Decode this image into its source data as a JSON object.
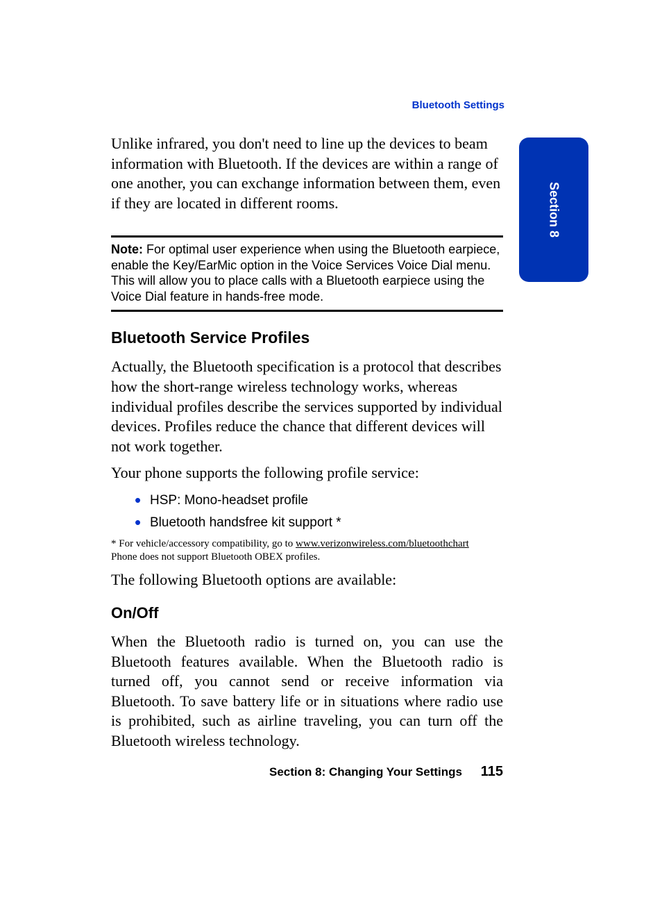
{
  "header": {
    "section_link": "Bluetooth Settings"
  },
  "side_tab": "Section 8",
  "intro": "Unlike infrared, you don't need to line up the devices to beam information with Bluetooth. If the devices are within a range of one another, you can exchange information between them, even if they are located in different rooms.",
  "note": {
    "label": "Note:",
    "text": " For optimal user experience when using the Bluetooth earpiece, enable the Key/EarMic option in the Voice Services Voice Dial menu. This will allow you to place calls with a Bluetooth earpiece using the Voice Dial feature in hands-free mode."
  },
  "h2_profiles": "Bluetooth Service Profiles",
  "profiles_p1": "Actually, the Bluetooth specification is a protocol that describes how the short-range wireless technology works, whereas individual profiles describe the services supported by individual devices. Profiles reduce the chance that different devices will not work together.",
  "profiles_p2": "Your phone supports the following profile service:",
  "bullets": [
    "HSP: Mono-headset profile",
    "Bluetooth handsfree kit support *"
  ],
  "footnote": {
    "prefix": "* For vehicle/accessory compatibility, go to ",
    "link": "www.verizonwireless.com/bluetoothchart",
    "line2": "Phone does not support Bluetooth OBEX profiles."
  },
  "options_intro": "The following Bluetooth options are available:",
  "h3_onoff": "On/Off",
  "onoff_body": "When the Bluetooth radio is turned on, you can use the Bluetooth features available. When the Bluetooth radio is turned off, you cannot send or receive information via Bluetooth. To save battery life or in situations where radio use is prohibited, such as airline traveling, you can turn off the Bluetooth wireless technology.",
  "footer": {
    "section": "Section 8: Changing Your Settings",
    "page": "115"
  }
}
